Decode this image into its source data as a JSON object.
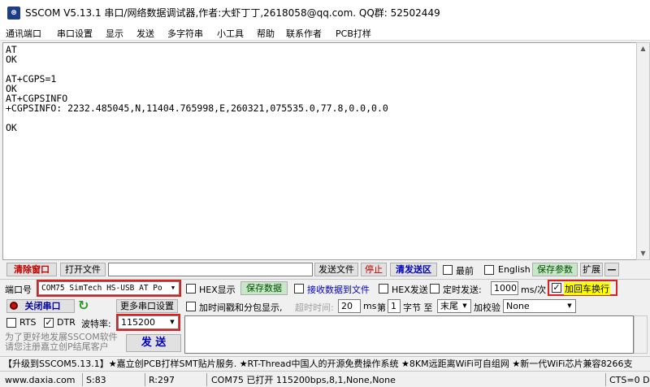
{
  "window": {
    "title": "SSCOM V5.13.1 串口/网络数据调试器,作者:大虾丁丁,2618058@qq.com. QQ群: 52502449",
    "icon": "serial-app-icon"
  },
  "menu": [
    "通讯端口",
    "串口设置",
    "显示",
    "发送",
    "多字符串",
    "小工具",
    "帮助",
    "联系作者",
    "PCB打样"
  ],
  "terminal": {
    "lines": [
      "AT",
      "OK",
      "",
      "AT+CGPS=1",
      "OK",
      "AT+CGPSINFO",
      "+CGPSINFO: 2232.485045,N,11404.765998,E,260321,075535.0,77.8,0.0,0.0",
      "",
      "OK"
    ]
  },
  "toolbar": {
    "clear_window": "清除窗口",
    "open_file": "打开文件",
    "send_file": "发送文件",
    "stop": "停止",
    "clear_send": "清发送区",
    "topmost": "最前",
    "english": "English",
    "save_params": "保存参数",
    "expand": "扩展",
    "collapse": "—"
  },
  "port": {
    "port_label": "端口号",
    "port_value": "COM75 SimTech HS-USB AT Po",
    "close_port": "关闭串口",
    "more_settings": "更多串口设置",
    "rts": "RTS",
    "dtr": "DTR",
    "baud_label": "波特率:",
    "baud_value": "115200",
    "promo_line1": "为了更好地发展SSCOM软件",
    "promo_line2": "请您注册嘉立创P结尾客户",
    "send": "发 送"
  },
  "options": {
    "hex_display": "HEX显示",
    "save_data": "保存数据",
    "recv_to_file": "接收数据到文件",
    "hex_send": "HEX发送",
    "timed_send": "定时发送:",
    "timed_value": "1000",
    "timed_unit": "ms/次",
    "add_crlf": "加回车换行",
    "add_timestamp": "加时间戳和分包显示,",
    "timeout_label": "超时时间:",
    "timeout_value": "20",
    "timeout_unit": "ms",
    "byte_prefix": "第",
    "byte_value": "1",
    "byte_mid": "字节 至",
    "byte_end": "末尾",
    "checksum_label": "加校验",
    "checksum_value": "None"
  },
  "promo_bar": "【升级到SSCOM5.13.1】★嘉立创PCB打样SMT贴片服务. ★RT-Thread中国人的开源免费操作系统 ★8KM远距离WiFi可自组网 ★新一代WiFi芯片兼容8266支",
  "status": {
    "website": "www.daxia.com",
    "sent": "S:83",
    "received": "R:297",
    "port_state": "COM75 已打开  115200bps,8,1,None,None",
    "cts": "CTS=0 D"
  }
}
